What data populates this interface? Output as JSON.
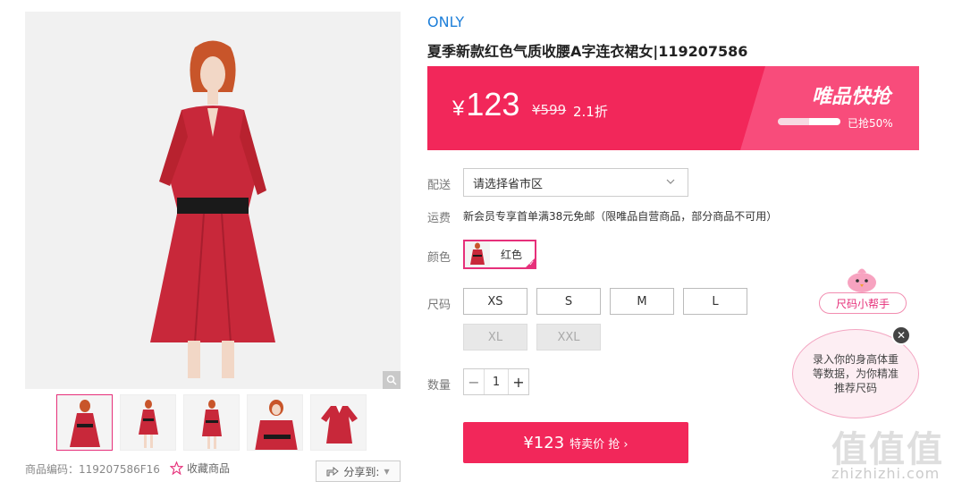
{
  "product": {
    "brand": "ONLY",
    "title": "夏季新款红色气质收腰A字连衣裙女|119207586",
    "code_label": "商品编码：",
    "code": "119207586F16"
  },
  "price": {
    "currency": "¥",
    "current": "123",
    "original": "¥599",
    "discount": "2.1折",
    "flash_title": "唯品快抢",
    "sold_text": "已抢50%",
    "sold_fraction": 0.5
  },
  "delivery": {
    "label": "配送",
    "placeholder": "请选择省市区"
  },
  "shipping": {
    "label": "运费",
    "text": "新会员专享首单满38元免邮（限唯品自营商品，部分商品不可用）"
  },
  "color": {
    "label": "颜色",
    "selected": "红色"
  },
  "sizes": {
    "label": "尺码",
    "options": [
      {
        "name": "XS",
        "available": true
      },
      {
        "name": "S",
        "available": true
      },
      {
        "name": "M",
        "available": true
      },
      {
        "name": "L",
        "available": true
      },
      {
        "name": "XL",
        "available": false
      },
      {
        "name": "XXL",
        "available": false
      }
    ]
  },
  "quantity": {
    "label": "数量",
    "value": "1",
    "minus": "−",
    "plus": "+"
  },
  "buy_button": {
    "price": "¥123",
    "text": "特卖价 抢 ›"
  },
  "actions": {
    "favorite": "收藏商品",
    "share": "分享到:"
  },
  "size_helper": {
    "label": "尺码小帮手",
    "bubble_text": "录入你的身高体重等数据，为你精准推荐尺码"
  },
  "watermark": {
    "glyphs": "值值值",
    "site": "zhizhizhi.com"
  },
  "colors": {
    "accent_pink": "#f2275a",
    "brand_blue": "#1e7fd9",
    "dress_red": "#c8283a"
  }
}
